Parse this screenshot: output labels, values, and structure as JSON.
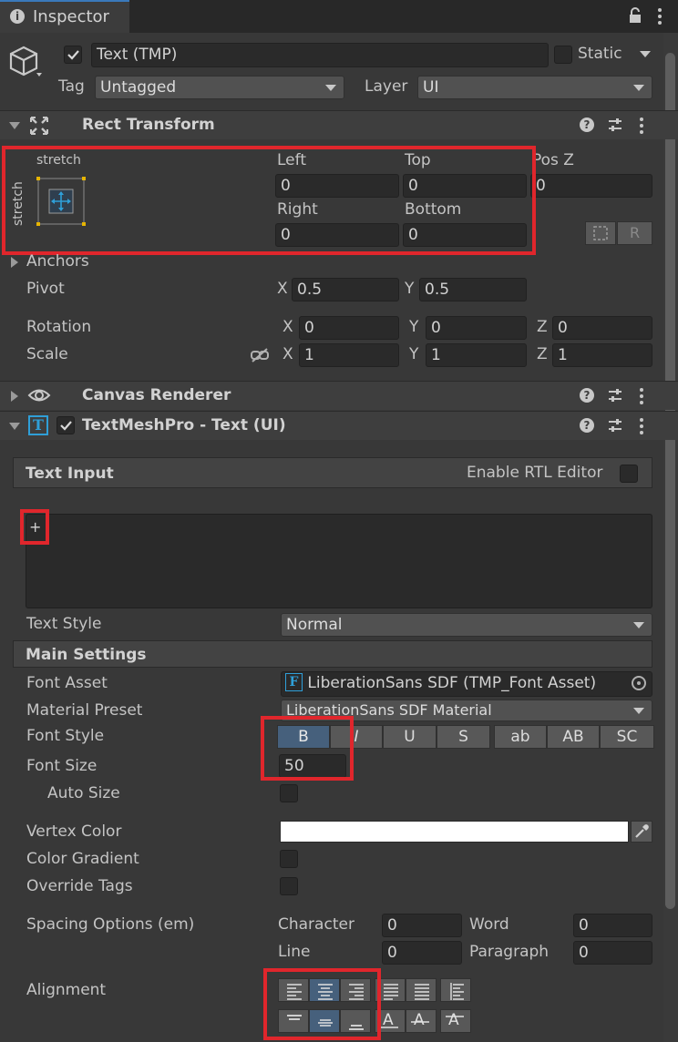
{
  "tab": {
    "title": "Inspector",
    "info_icon": "info-icon"
  },
  "object": {
    "name": "Text (TMP)",
    "static_label": "Static",
    "tag_label": "Tag",
    "tag_value": "Untagged",
    "layer_label": "Layer",
    "layer_value": "UI"
  },
  "rect_transform": {
    "title": "Rect Transform",
    "anchor_preset_top": "stretch",
    "anchor_preset_side": "stretch",
    "left_label": "Left",
    "left_value": "0",
    "top_label": "Top",
    "top_value": "0",
    "posz_label": "Pos Z",
    "posz_value": "0",
    "right_label": "Right",
    "right_value": "0",
    "bottom_label": "Bottom",
    "bottom_value": "0",
    "raw_button": "R",
    "anchors_label": "Anchors",
    "pivot_label": "Pivot",
    "pivot_x_label": "X",
    "pivot_x": "0.5",
    "pivot_y_label": "Y",
    "pivot_y": "0.5",
    "rotation_label": "Rotation",
    "rot_x_label": "X",
    "rot_x": "0",
    "rot_y_label": "Y",
    "rot_y": "0",
    "rot_z_label": "Z",
    "rot_z": "0",
    "scale_label": "Scale",
    "scale_x_label": "X",
    "scale_x": "1",
    "scale_y_label": "Y",
    "scale_y": "1",
    "scale_z_label": "Z",
    "scale_z": "1"
  },
  "canvas_renderer": {
    "title": "Canvas Renderer"
  },
  "tmp": {
    "title": "TextMeshPro - Text (UI)",
    "text_input_label": "Text Input",
    "enable_rtl_label": "Enable RTL Editor",
    "text_area_value": "+",
    "text_style_label": "Text Style",
    "text_style_value": "Normal",
    "main_settings_label": "Main Settings",
    "font_asset_label": "Font Asset",
    "font_asset_value": "LiberationSans SDF (TMP_Font Asset)",
    "font_asset_glyph": "F",
    "material_preset_label": "Material Preset",
    "material_preset_value": "LiberationSans SDF Material",
    "font_style_label": "Font Style",
    "font_style_buttons": [
      "B",
      "I",
      "U",
      "S",
      "ab",
      "AB",
      "SC"
    ],
    "font_size_label": "Font Size",
    "font_size_value": "50",
    "auto_size_label": "Auto Size",
    "vertex_color_label": "Vertex Color",
    "vertex_color": "#ffffff",
    "color_gradient_label": "Color Gradient",
    "override_tags_label": "Override Tags",
    "spacing_label": "Spacing Options (em)",
    "character_label": "Character",
    "character_value": "0",
    "word_label": "Word",
    "word_value": "0",
    "line_label": "Line",
    "line_value": "0",
    "paragraph_label": "Paragraph",
    "paragraph_value": "0",
    "alignment_label": "Alignment",
    "vertical_glyph": "A"
  },
  "colors": {
    "background": "#383838",
    "field": "#2a2a2a",
    "active": "#46607c",
    "highlight": "#e0262c",
    "accent_icon": "#2f9fd8"
  }
}
